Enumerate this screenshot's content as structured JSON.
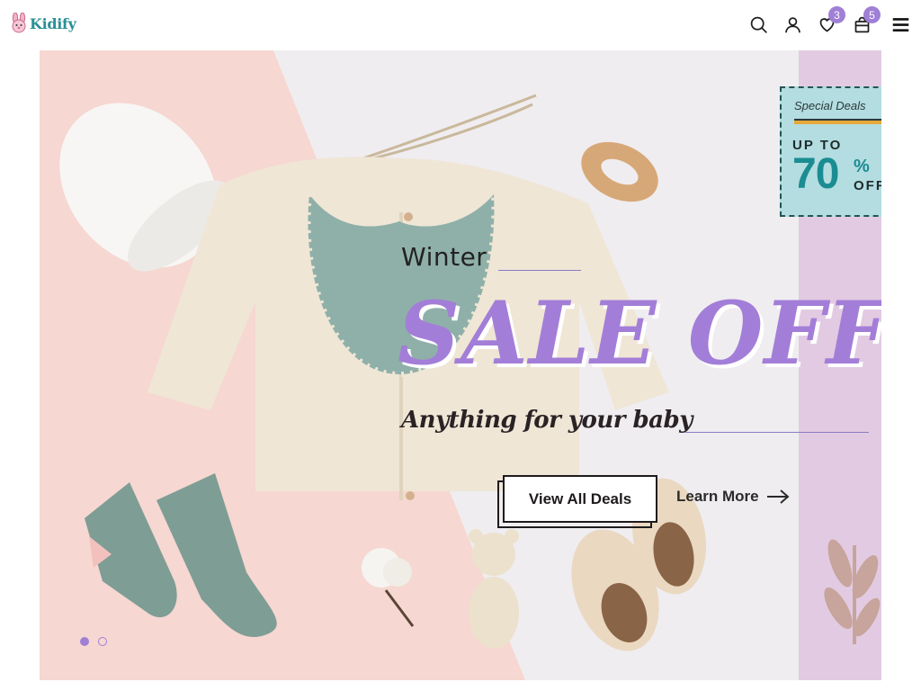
{
  "header": {
    "logo_text": "Kidify",
    "wishlist_count": "3",
    "cart_count": "5"
  },
  "hero": {
    "kicker": "Winter",
    "headline": "SALE OFF",
    "tagline": "Anything for your baby",
    "primary_cta": "View All Deals",
    "secondary_cta": "Learn More",
    "slide_count": 2,
    "active_slide": 1
  },
  "deal_card": {
    "title": "Special Deals",
    "up_to": "UP TO",
    "amount": "70",
    "percent_sign": "%",
    "off": "OFF"
  },
  "colors": {
    "brand_teal": "#2a8f95",
    "accent_purple": "#a37ed8",
    "pink_panel": "#f6d7d1",
    "lavender_panel": "#e2cbe2",
    "deal_bg": "#b3dde0"
  },
  "icons": [
    "search-icon",
    "user-icon",
    "heart-icon",
    "bag-icon",
    "menu-icon",
    "arrow-right-icon",
    "bunny-logo-icon"
  ]
}
